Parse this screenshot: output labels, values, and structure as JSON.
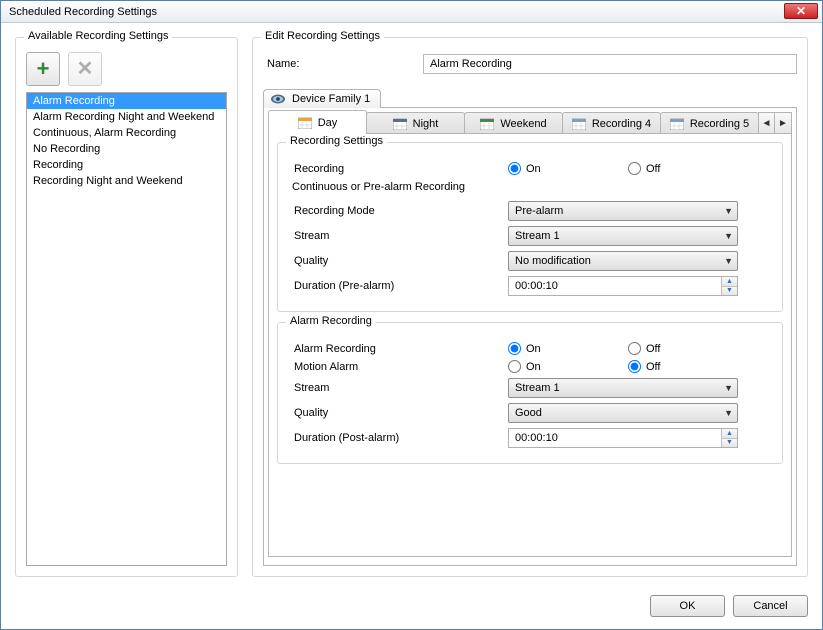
{
  "window": {
    "title": "Scheduled Recording Settings"
  },
  "available": {
    "legend": "Available Recording Settings",
    "items": [
      "Alarm Recording",
      "Alarm Recording Night and Weekend",
      "Continuous, Alarm Recording",
      "No Recording",
      "Recording",
      "Recording Night and Weekend"
    ],
    "selected_index": 0
  },
  "edit": {
    "legend": "Edit Recording Settings",
    "name_label": "Name:",
    "name_value": "Alarm Recording"
  },
  "device_tab": {
    "label": "Device Family 1"
  },
  "schedule_tabs": [
    {
      "label": "Day",
      "color": "#e3a44a"
    },
    {
      "label": "Night",
      "color": "#5a6b8c"
    },
    {
      "label": "Weekend",
      "color": "#3f8c46"
    },
    {
      "label": "Recording 4",
      "color": "#7aa1c4"
    },
    {
      "label": "Recording 5",
      "color": "#7aa1c4"
    }
  ],
  "active_schedule_tab": 0,
  "recording_settings": {
    "legend": "Recording Settings",
    "recording_label": "Recording",
    "recording_on": "On",
    "recording_off": "Off",
    "recording_value": "On",
    "continuous_legend": "Continuous or Pre-alarm Recording",
    "mode_label": "Recording Mode",
    "mode_value": "Pre-alarm",
    "stream_label": "Stream",
    "stream_value": "Stream 1",
    "quality_label": "Quality",
    "quality_value": "No modification",
    "duration_pre_label": "Duration (Pre-alarm)",
    "duration_pre_value": "00:00:10"
  },
  "alarm_recording": {
    "legend": "Alarm Recording",
    "alarm_label": "Alarm Recording",
    "alarm_value": "On",
    "motion_label": "Motion Alarm",
    "motion_value": "Off",
    "on": "On",
    "off": "Off",
    "stream_label": "Stream",
    "stream_value": "Stream 1",
    "quality_label": "Quality",
    "quality_value": "Good",
    "duration_post_label": "Duration (Post-alarm)",
    "duration_post_value": "00:00:10"
  },
  "footer": {
    "ok": "OK",
    "cancel": "Cancel"
  }
}
